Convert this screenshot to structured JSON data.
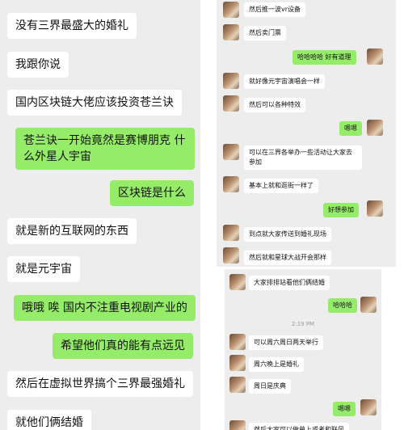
{
  "left_chat": {
    "messages": [
      {
        "side": "in",
        "text": "没有三界最盛大的婚礼"
      },
      {
        "side": "in",
        "text": "我跟你说"
      },
      {
        "side": "in",
        "text": "国内区块链大佬应该投资苍兰诀"
      },
      {
        "side": "out",
        "text": "苍兰诀一开始竟然是赛博朋克 什么外星人宇宙"
      },
      {
        "side": "out",
        "text": "区块链是什么"
      },
      {
        "side": "in",
        "text": "就是新的互联网的东西"
      },
      {
        "side": "in",
        "text": "就是元宇宙"
      },
      {
        "side": "out",
        "text": "哦哦 唉 国内不注重电视剧产业的"
      },
      {
        "side": "out",
        "text": "希望他们真的能有点远见"
      },
      {
        "side": "in",
        "text": "然后在虚拟世界搞个三界最强婚礼"
      },
      {
        "side": "in",
        "text": "就他们俩结婚"
      }
    ]
  },
  "right_top_chat": {
    "messages": [
      {
        "side": "in",
        "text": "然后推一波vr设备"
      },
      {
        "side": "in",
        "text": "然后卖门票"
      },
      {
        "side": "out",
        "text": "哈哈哈哈 好有道理"
      },
      {
        "side": "in",
        "text": "就好像元宇宙演唱会一样"
      },
      {
        "side": "in",
        "text": "然后可以各种特效"
      },
      {
        "side": "out",
        "text": "嗯嗯"
      },
      {
        "side": "in",
        "text": "可以在三界各举办一些活动让大家去参加"
      },
      {
        "side": "in",
        "text": "基本上就和逛街一样了"
      },
      {
        "side": "out",
        "text": "好想参加"
      },
      {
        "side": "in",
        "text": "到点就大家传送到婚礼现场"
      },
      {
        "side": "in",
        "text": "然后就和星球大战开会那样"
      }
    ]
  },
  "right_bottom_chat": {
    "messages": [
      {
        "side": "in",
        "text": "大家排排站看他们俩结婚"
      },
      {
        "side": "out",
        "text": "哈哈哈"
      }
    ],
    "timestamp": "2:19 PM",
    "messages_after": [
      {
        "side": "in",
        "text": "可以周六周日两天举行"
      },
      {
        "side": "in",
        "text": "周六晚上是婚礼"
      },
      {
        "side": "in",
        "text": "周日是庆典"
      },
      {
        "side": "out",
        "text": "嗯嗯"
      },
      {
        "side": "in",
        "text": "然后大家可以做单上或者和联风"
      }
    ]
  }
}
